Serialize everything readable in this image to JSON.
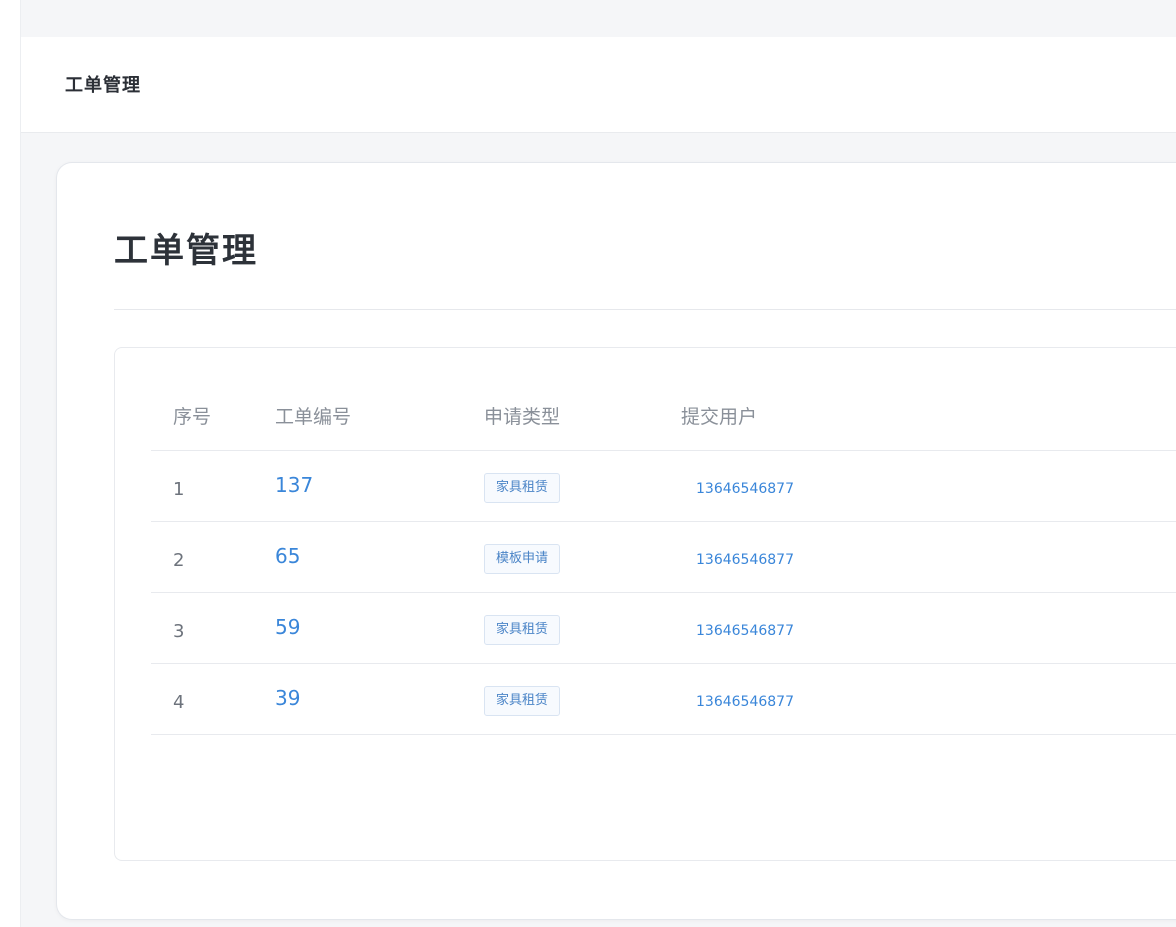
{
  "header": {
    "title": "工单管理"
  },
  "card": {
    "title": "工单管理"
  },
  "table": {
    "columns": [
      "序号",
      "工单编号",
      "申请类型",
      "提交用户"
    ],
    "rows": [
      {
        "index": "1",
        "order_no": "137",
        "type": "家具租赁",
        "user": "13646546877"
      },
      {
        "index": "2",
        "order_no": "65",
        "type": "模板申请",
        "user": "13646546877"
      },
      {
        "index": "3",
        "order_no": "59",
        "type": "家具租赁",
        "user": "13646546877"
      },
      {
        "index": "4",
        "order_no": "39",
        "type": "家具租赁",
        "user": "13646546877"
      }
    ]
  },
  "colors": {
    "link": "#3a86d9",
    "tag_border": "#d9e4f2",
    "header_text": "#8a9099"
  }
}
